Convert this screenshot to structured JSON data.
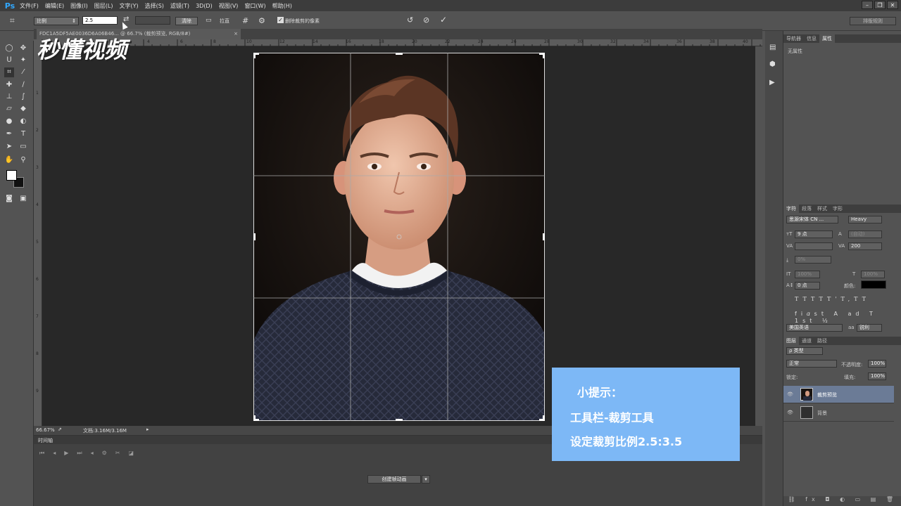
{
  "app": {
    "logo": "Ps"
  },
  "menu": [
    "文件(F)",
    "编辑(E)",
    "图像(I)",
    "图层(L)",
    "文字(Y)",
    "选择(S)",
    "滤镜(T)",
    "3D(D)",
    "视图(V)",
    "窗口(W)",
    "帮助(H)"
  ],
  "window_buttons": [
    "–",
    "❐",
    "✕"
  ],
  "options": {
    "ratio_preset": "比例",
    "width_value": "2.5",
    "height_value": "",
    "clear_label": "清除",
    "straighten_label": "拉直",
    "delete_pixels_label": "删除裁剪的像素",
    "delete_pixels_checked": true,
    "workspace_label": "排版规则"
  },
  "document": {
    "tab_title": "FDC1A5DF5AE0036D6A06B46... @ 66.7% (裁剪预览, RGB/8#)",
    "zoom": "66.67%",
    "doc_size": "文档:3.16M/3.16M"
  },
  "ruler": {
    "top": [
      "2",
      "0",
      "2",
      "4",
      "6",
      "8",
      "10",
      "12",
      "14",
      "16",
      "18",
      "20",
      "22",
      "24",
      "26",
      "28",
      "30",
      "32",
      "34",
      "36",
      "38",
      "40"
    ],
    "left": [
      "1",
      "2",
      "3",
      "4",
      "5",
      "6",
      "7",
      "8",
      "9"
    ]
  },
  "watermark": "秒懂视频",
  "timeline": {
    "tab": "时间轴",
    "create_button": "创建帧动画"
  },
  "panels": {
    "top_tabs": [
      "导航器",
      "信息",
      "属性"
    ],
    "properties_text": "无属性",
    "char_tabs": [
      "字符",
      "段落",
      "样式",
      "字形"
    ],
    "font_family": "思源宋体 CN ...",
    "font_style": "Heavy",
    "font_size": "9 点",
    "leading": "(自动)",
    "kerning": "",
    "tracking": "200",
    "vscale_pct": "0%",
    "scale_a": "100%",
    "scale_b": "100%",
    "baseline": "0 点",
    "color_label": "颜色:",
    "language": "美国英语",
    "aa_label": "aa",
    "aa_mode": "锐利",
    "layers_tabs": [
      "图层",
      "通道",
      "路径"
    ],
    "filter_kind": "ρ 类型",
    "blend_mode": "正常",
    "opacity_label": "不透明度:",
    "opacity_value": "100%",
    "lock_label": "锁定:",
    "fill_label": "填充:",
    "fill_value": "100%",
    "layers": [
      {
        "name": "裁剪预览",
        "selected": true
      },
      {
        "name": "背景",
        "selected": false
      }
    ]
  },
  "tip": {
    "title": "小提示：",
    "line1": "工具栏-裁剪工具",
    "line2": "设定裁剪比例2.5:3.5"
  },
  "colors": {
    "accent": "#31a8ff",
    "tip_bg": "#7db8f6",
    "panel_bg": "#535353",
    "workspace": "#282828"
  }
}
